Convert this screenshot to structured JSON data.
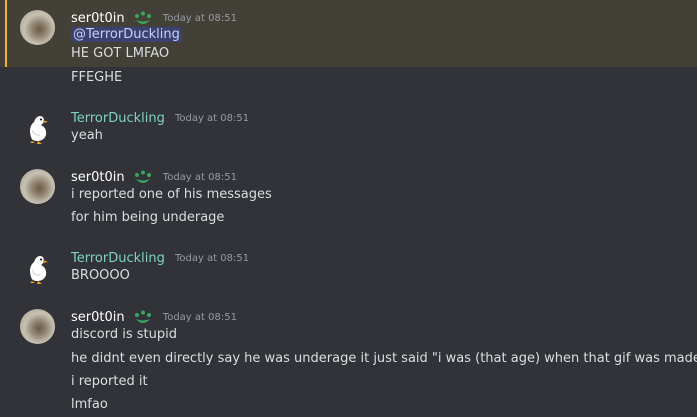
{
  "messages": [
    {
      "author": "ser0t0in",
      "timestamp": "Today at 08:51",
      "lines": [
        "@TerrorDuckling",
        "HE GOT LMFAO",
        "FFEGHE"
      ]
    },
    {
      "author": "TerrorDuckling",
      "timestamp": "Today at 08:51",
      "lines": [
        "yeah"
      ]
    },
    {
      "author": "ser0t0in",
      "timestamp": "Today at 08:51",
      "lines": [
        "i reported one of his messages",
        "for him being underage"
      ]
    },
    {
      "author": "TerrorDuckling",
      "timestamp": "Today at 08:51",
      "lines": [
        "BROOOO"
      ]
    },
    {
      "author": "ser0t0in",
      "timestamp": "Today at 08:51",
      "lines": [
        "discord is stupid",
        "he didnt even directly say he was underage it just said \"i was (that age) when that gif was made)",
        "i reported it",
        "lmfao"
      ]
    }
  ],
  "colors": {
    "background": "#313338",
    "highlight_background": "#434037",
    "highlight_bar": "#f0b232",
    "mention_background": "#3c4270",
    "mention_text": "#c9cdfb",
    "username_default": "#ffffff",
    "username_terrorduckling": "#7fd3c0",
    "timestamp": "#949ba4",
    "message_text": "#dbdee1",
    "badge": "#3ba55d"
  },
  "icons": {
    "ser0t0in_badge": "sprout-icon",
    "ser0t0in_avatar": "cat-avatar",
    "terrorduckling_avatar": "duck-avatar"
  }
}
